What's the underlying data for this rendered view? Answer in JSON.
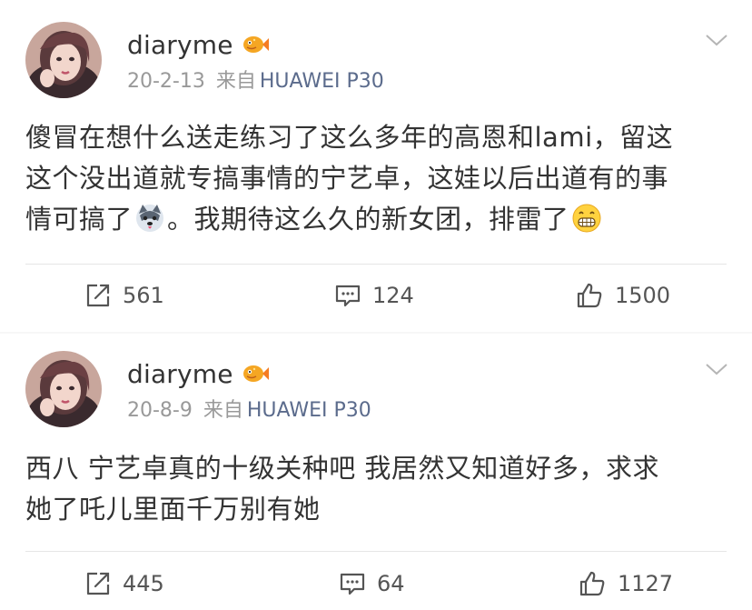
{
  "posts": [
    {
      "username": "diaryme",
      "date": "20-2-13",
      "from_label": "来自",
      "device": "HUAWEI P30",
      "text_line1": "傻冒在想什么送走练习了这么多年的高恩和lami，留这",
      "text_line2": "这个没出道就专搞事情的宁艺卓，这娃以后出道有的事",
      "text_line3a": "情可搞了",
      "text_line3b": "。我期待这么久的新女团，排雷了",
      "repost_count": "561",
      "comment_count": "124",
      "like_count": "1500"
    },
    {
      "username": "diaryme",
      "date": "20-8-9",
      "from_label": "来自",
      "device": "HUAWEI P30",
      "text_line1": "西八 宁艺卓真的十级关种吧 我居然又知道好多，求求",
      "text_line2": "她了吒儿里面千万别有她",
      "repost_count": "445",
      "comment_count": "64",
      "like_count": "1127"
    }
  ],
  "icons": {
    "badge": "vip-fish-badge-icon",
    "chevron": "chevron-down-icon",
    "repost": "repost-icon",
    "comment": "comment-icon",
    "like": "thumbs-up-icon",
    "emoji1": "husky-dog-emoji-icon",
    "emoji2": "grin-emoji-icon"
  },
  "colors": {
    "text": "#333333",
    "meta": "#999999",
    "device": "#5b6b8c",
    "divider": "#e6e6e6"
  }
}
